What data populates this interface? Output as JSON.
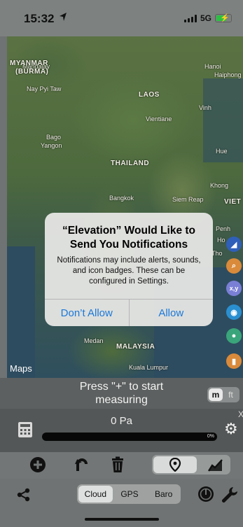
{
  "status_bar": {
    "time": "15:32",
    "network": "5G",
    "location_icon": "location-arrow-icon"
  },
  "map": {
    "attribution": "Maps",
    "labels": [
      {
        "text": "Mandalay",
        "cls": "small"
      },
      {
        "text": "MYANMAR",
        "cls": ""
      },
      {
        "text": "(BURMA)",
        "cls": ""
      },
      {
        "text": "Nay Pyi Taw",
        "cls": "small"
      },
      {
        "text": "Hanoi",
        "cls": "small"
      },
      {
        "text": "Haiphong",
        "cls": "small"
      },
      {
        "text": "LAOS",
        "cls": ""
      },
      {
        "text": "Vinh",
        "cls": "small"
      },
      {
        "text": "Vientiane",
        "cls": "small"
      },
      {
        "text": "Bago",
        "cls": "small"
      },
      {
        "text": "Yangon",
        "cls": "small"
      },
      {
        "text": "Hue",
        "cls": "small"
      },
      {
        "text": "THAILAND",
        "cls": ""
      },
      {
        "text": "Khong",
        "cls": "small"
      },
      {
        "text": "Bangkok",
        "cls": "small"
      },
      {
        "text": "Siem Reap",
        "cls": "small"
      },
      {
        "text": "VIET",
        "cls": ""
      },
      {
        "text": "Penh",
        "cls": "small"
      },
      {
        "text": "Ho",
        "cls": "small"
      },
      {
        "text": "Tho",
        "cls": "small"
      },
      {
        "text": "MALAYSIA",
        "cls": ""
      },
      {
        "text": "Medan",
        "cls": "small"
      },
      {
        "text": "Kuala Lumpur",
        "cls": "small"
      }
    ],
    "side_buttons": [
      {
        "name": "compass-icon",
        "color": "#2f5fb8",
        "glyph": "◢"
      },
      {
        "name": "search-location-icon",
        "color": "#d98a3a",
        "glyph": "⚲"
      },
      {
        "name": "xy-coordinates-icon",
        "color": "#7a7fd6",
        "glyph": "x,y"
      },
      {
        "name": "globe-icon",
        "color": "#2a8fd0",
        "glyph": "◉"
      },
      {
        "name": "map-pin-icon",
        "color": "#3aa57a",
        "glyph": "⚲"
      },
      {
        "name": "book-icon",
        "color": "#d98a3a",
        "glyph": "▮"
      }
    ]
  },
  "alert": {
    "title": "“Elevation” Would Like to Send You Notifications",
    "message": "Notifications may include alerts, sounds, and icon badges. These can be configured in Settings.",
    "deny_label": "Don’t Allow",
    "allow_label": "Allow"
  },
  "measure": {
    "prompt": "Press \"+\" to start measuring",
    "unit_m": "m",
    "unit_ft": "ft",
    "pressure": "0 Pa",
    "progress_label": "0%",
    "progress_value": 0
  },
  "sources": {
    "cloud": "Cloud",
    "gps": "GPS",
    "baro": "Baro",
    "selected": "Cloud"
  }
}
